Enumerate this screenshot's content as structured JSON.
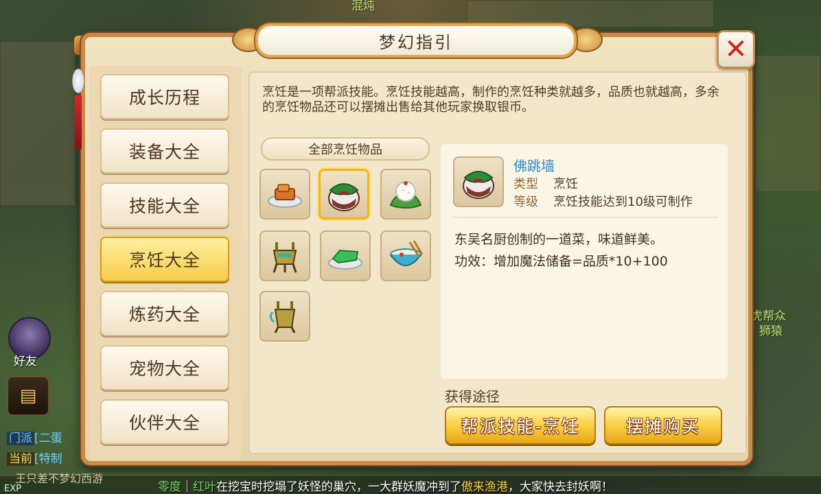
{
  "background": {
    "npc_top_label": "混炖",
    "npc_right_label_1": "虎帮众",
    "npc_right_label_2": "狮猿",
    "friend_label": "好友",
    "channels": [
      {
        "tag": "门派",
        "text": "[二蛋"
      },
      {
        "tag": "当前",
        "text": "[特制"
      }
    ],
    "chat_line": "王只差不梦幻西游",
    "exp_label": "EXP",
    "marquee": {
      "name1": "零度",
      "sep": "｜",
      "name2": "红叶",
      "text1": "在挖宝时挖塌了妖怪的巢穴，一大群妖魔冲到了",
      "place": "傲来渔港",
      "text2": "，大家快去封妖啊！"
    }
  },
  "dialog": {
    "title": "梦幻指引",
    "close_icon": "close-x-icon"
  },
  "nav": {
    "items": [
      {
        "label": "成长历程",
        "active": false
      },
      {
        "label": "装备大全",
        "active": false
      },
      {
        "label": "技能大全",
        "active": false
      },
      {
        "label": "烹饪大全",
        "active": true
      },
      {
        "label": "炼药大全",
        "active": false
      },
      {
        "label": "宠物大全",
        "active": false
      },
      {
        "label": "伙伴大全",
        "active": false
      }
    ]
  },
  "content": {
    "description": "烹饪是一项帮派技能。烹饪技能越高，制作的烹饪种类就越多，品质也就越高，多余的烹饪物品还可以摆摊出售给其他玩家换取银币。",
    "category_header": "全部烹饪物品",
    "items": [
      {
        "icon": "tofu-dish-icon",
        "selected": false
      },
      {
        "icon": "fotiaoqiang-jar-icon",
        "selected": true
      },
      {
        "icon": "rice-dumpling-icon",
        "selected": false
      },
      {
        "icon": "bronze-vessel-icon",
        "selected": false
      },
      {
        "icon": "green-jelly-icon",
        "selected": false
      },
      {
        "icon": "noodle-bowl-icon",
        "selected": false
      },
      {
        "icon": "bronze-cup-icon",
        "selected": false
      }
    ]
  },
  "detail": {
    "name": "佛跳墙",
    "type_label": "类型",
    "type_value": "烹饪",
    "level_label": "等级",
    "level_value": "烹饪技能达到10级可制作",
    "flavor": "东吴名厨创制的一道菜，味道鲜美。",
    "effect": "功效：增加魔法储备=品质*10+100"
  },
  "obtain": {
    "label": "获得途径",
    "buttons": [
      {
        "label": "帮派技能-烹饪"
      },
      {
        "label": "摆摊购买"
      }
    ]
  },
  "colors": {
    "accent_gold": "#f9cf46",
    "name_blue": "#2b88c8",
    "close_red": "#d41f1f"
  }
}
